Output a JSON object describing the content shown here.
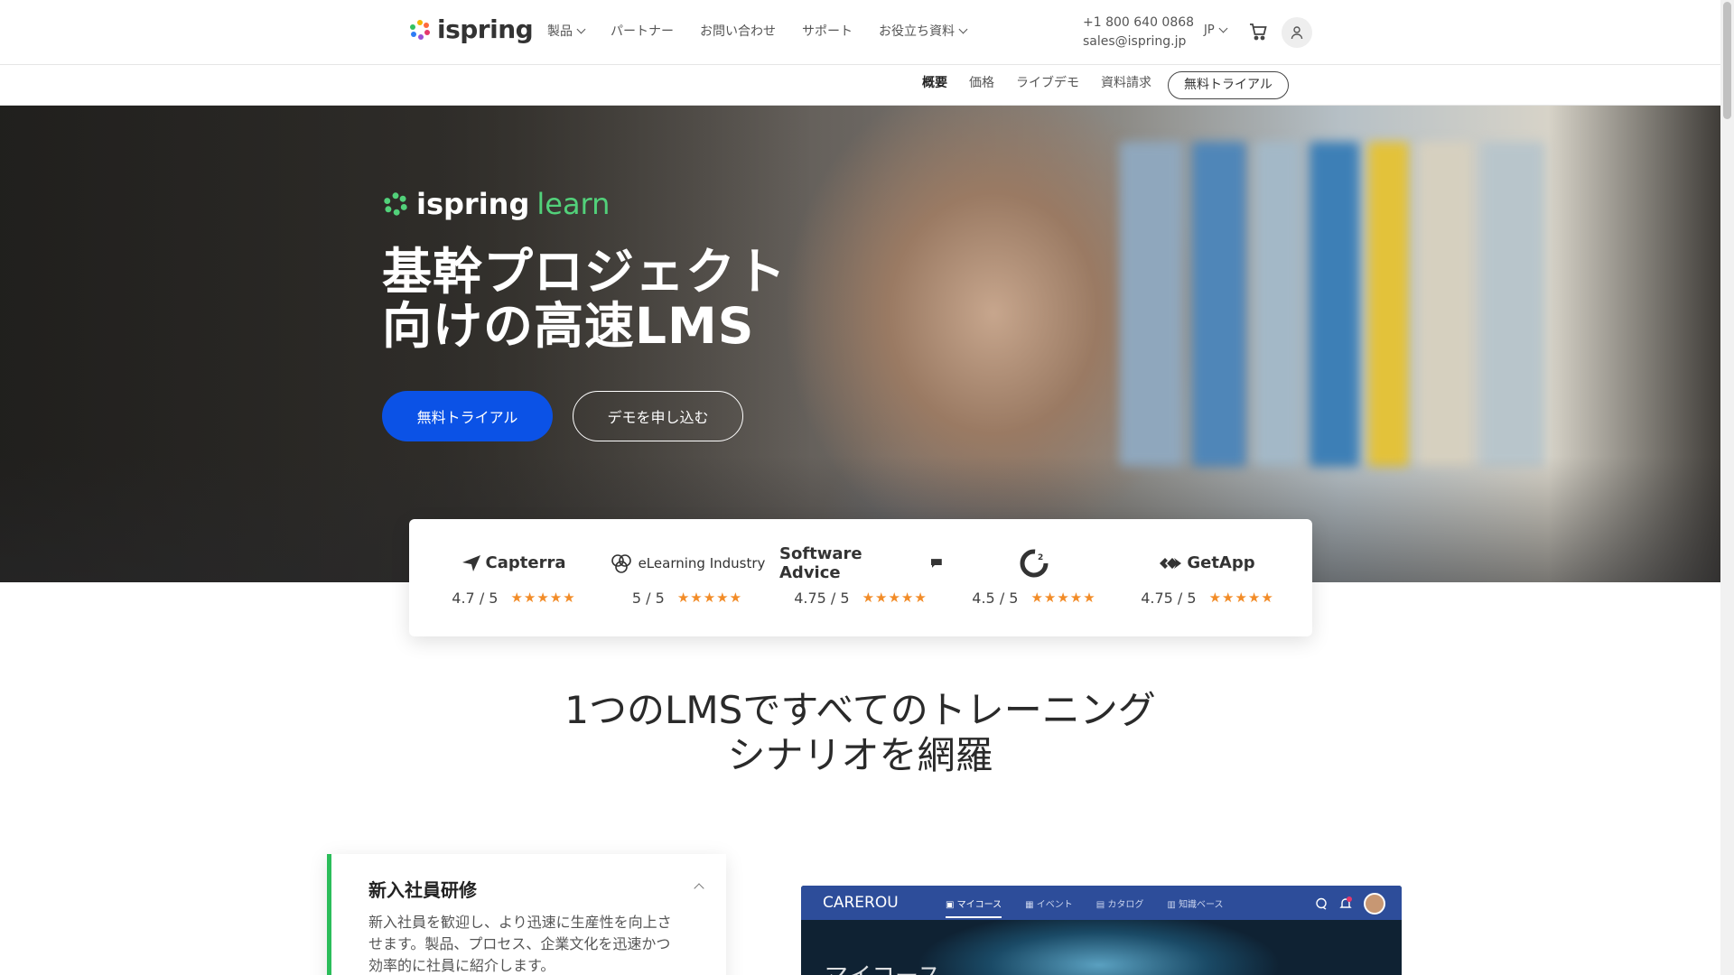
{
  "header": {
    "logo_text": "ispring",
    "nav": [
      {
        "label": "製品",
        "dropdown": true
      },
      {
        "label": "パートナー",
        "dropdown": false
      },
      {
        "label": "お問い合わせ",
        "dropdown": false
      },
      {
        "label": "サポート",
        "dropdown": false
      },
      {
        "label": "お役立ち資料",
        "dropdown": true
      }
    ],
    "phone": "+1 800 640 0868",
    "email": "sales@ispring.jp",
    "language": "JP"
  },
  "subnav": {
    "items": [
      {
        "label": "概要",
        "active": true
      },
      {
        "label": "価格",
        "active": false
      },
      {
        "label": "ライブデモ",
        "active": false
      },
      {
        "label": "資料請求",
        "active": false
      }
    ],
    "trial_button": "無料トライアル"
  },
  "hero": {
    "product_name": "ispring",
    "product_suffix": "learn",
    "title_line1": "基幹プロジェクト",
    "title_line2": "向けの高速LMS",
    "primary_button": "無料トライアル",
    "secondary_button": "デモを申し込む"
  },
  "ratings": [
    {
      "name": "Capterra",
      "score": "4.7 / 5",
      "stars": "★★★★★"
    },
    {
      "name": "eLearning Industry",
      "score": "5 / 5",
      "stars": "★★★★★"
    },
    {
      "name": "Software Advice",
      "score": "4.75 / 5",
      "stars": "★★★★★"
    },
    {
      "name": "G2",
      "score": "4.5 / 5",
      "stars": "★★★★★"
    },
    {
      "name": "GetApp",
      "score": "4.75 / 5",
      "stars": "★★★★★"
    }
  ],
  "section": {
    "title_line1": "1つのLMSですべてのトレーニング",
    "title_line2": "シナリオを網羅"
  },
  "scenario_card": {
    "title": "新入社員研修",
    "text": "新入社員を歓迎し、より迅速に生産性を向上させます。製品、プロセス、企業文化を迅速かつ効率的に社員に紹介します。"
  },
  "app_preview": {
    "brand": "CAREROU",
    "tabs": [
      "マイコース",
      "イベント",
      "カタログ",
      "知識ベース"
    ],
    "heading": "マイコース"
  },
  "colors": {
    "primary_blue": "#0b52e6",
    "learn_green": "#52d17a",
    "star_orange": "#f28c28",
    "card_accent": "#2bbd5a",
    "app_bar": "#2d4d9a"
  }
}
